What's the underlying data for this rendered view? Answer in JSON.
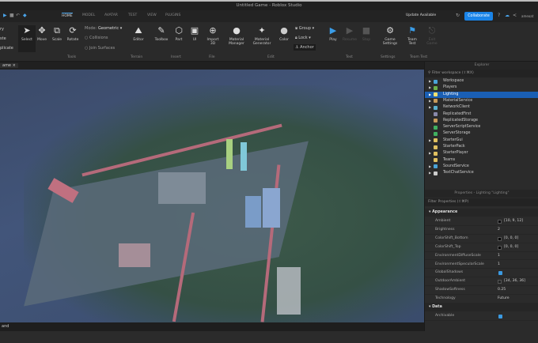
{
  "window": {
    "title": "Untitled Game - Roblox Studio"
  },
  "quick_access": {
    "partial_left": "ry"
  },
  "tabs": [
    {
      "label": "HOME",
      "active": true
    },
    {
      "label": "MODEL"
    },
    {
      "label": "AVATAR"
    },
    {
      "label": "TEST"
    },
    {
      "label": "VIEW"
    },
    {
      "label": "PLUGINS"
    }
  ],
  "top_right": {
    "update": "Update Available",
    "collaborate": "Collaborate",
    "user": "ameoat"
  },
  "ribbon": {
    "left_partial": [
      "ry",
      "ste",
      "plicate"
    ],
    "tools": {
      "select": "Select",
      "move": "Move",
      "scale": "Scale",
      "rotate": "Rotate",
      "mode_label": "Mode:",
      "mode_value": "Geometric",
      "collisions": "Collisions",
      "join": "Join Surfaces",
      "section": "Tools"
    },
    "terrain": {
      "editor": "Editor",
      "section": "Terrain"
    },
    "insert": {
      "toolbox": "Toolbox",
      "part": "Part",
      "ui": "UI",
      "section": "Insert"
    },
    "file": {
      "import": "Import 3D",
      "section": "File"
    },
    "edit": {
      "material_manager": "Material Manager",
      "material_generator": "Material Generator",
      "color": "Color",
      "group": "Group",
      "lock": "Lock",
      "anchor": "Anchor",
      "section": "Edit"
    },
    "test": {
      "play": "Play",
      "resume": "Resume",
      "stop": "Stop",
      "section": "Test"
    },
    "settings": {
      "game_settings": "Game Settings",
      "section": "Settings"
    },
    "team_test": {
      "team_test": "Team Test",
      "exit": "Exit Game",
      "section": "Team Test"
    }
  },
  "viewport_tab": "ame",
  "command_bar": "and",
  "explorer": {
    "title": "Explorer",
    "filter": "Filter workspace (⇧⌘X)",
    "items": [
      {
        "label": "Workspace",
        "color": "#4aa3d8",
        "arrow": true
      },
      {
        "label": "Players",
        "color": "#6cb04a",
        "arrow": true
      },
      {
        "label": "Lighting",
        "color": "#f0e070",
        "arrow": true,
        "selected": true
      },
      {
        "label": "MaterialService",
        "color": "#c79a5a",
        "arrow": true
      },
      {
        "label": "NetworkClient",
        "color": "#5ab0d0",
        "arrow": true
      },
      {
        "label": "ReplicatedFirst",
        "color": "#8888aa",
        "arrow": false
      },
      {
        "label": "ReplicatedStorage",
        "color": "#c79a5a",
        "arrow": false
      },
      {
        "label": "ServerScriptService",
        "color": "#40b060",
        "arrow": false
      },
      {
        "label": "ServerStorage",
        "color": "#40b060",
        "arrow": false
      },
      {
        "label": "StarterGui",
        "color": "#e0c060",
        "arrow": true
      },
      {
        "label": "StarterPack",
        "color": "#e0c060",
        "arrow": false
      },
      {
        "label": "StarterPlayer",
        "color": "#e0c060",
        "arrow": true
      },
      {
        "label": "Teams",
        "color": "#e0c060",
        "arrow": false
      },
      {
        "label": "SoundService",
        "color": "#4aa3d8",
        "arrow": true
      },
      {
        "label": "TextChatService",
        "color": "#cccccc",
        "arrow": true
      }
    ]
  },
  "properties": {
    "title": "Properties - Lighting \"Lighting\"",
    "filter": "Filter Properties (⇧⌘P)",
    "categories": [
      {
        "name": "Appearance",
        "rows": [
          {
            "key": "Ambient",
            "value": "[10, 9, 12]",
            "swatch": "#0a090c"
          },
          {
            "key": "Brightness",
            "value": "2"
          },
          {
            "key": "ColorShift_Bottom",
            "value": "[0, 0, 0]",
            "swatch": "#000000"
          },
          {
            "key": "ColorShift_Top",
            "value": "[0, 0, 0]",
            "swatch": "#000000"
          },
          {
            "key": "EnvironmentDiffuseScale",
            "value": "1"
          },
          {
            "key": "EnvironmentSpecularScale",
            "value": "1"
          },
          {
            "key": "GlobalShadows",
            "checked": true
          },
          {
            "key": "OutdoorAmbient",
            "value": "[34, 36, 36]",
            "swatch": "#222424"
          },
          {
            "key": "ShadowSoftness",
            "value": "0.25"
          },
          {
            "key": "Technology",
            "value": "Future"
          }
        ]
      },
      {
        "name": "Data",
        "rows": [
          {
            "key": "Archivable",
            "checked": true
          }
        ]
      }
    ]
  }
}
